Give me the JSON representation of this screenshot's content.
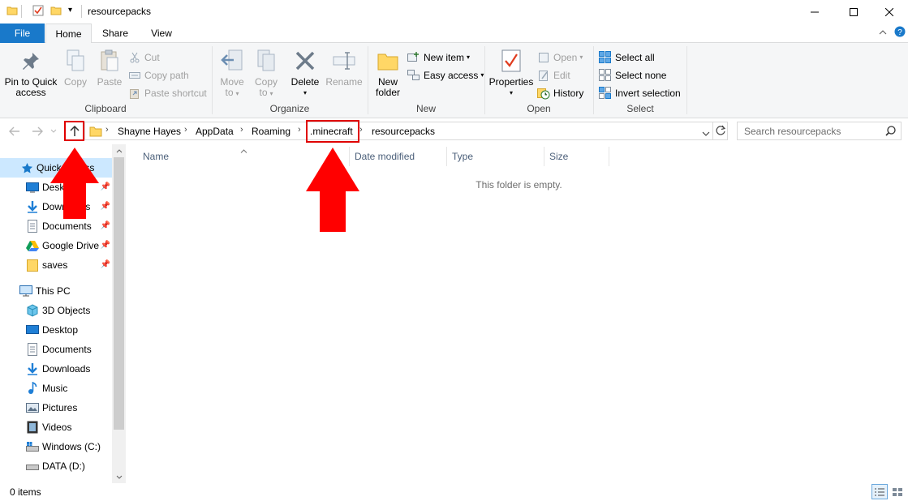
{
  "window": {
    "title": "resourcepacks",
    "qa_dropdown_glyph": "▾"
  },
  "tabs": [
    {
      "id": "file",
      "label": "File"
    },
    {
      "id": "home",
      "label": "Home"
    },
    {
      "id": "share",
      "label": "Share"
    },
    {
      "id": "view",
      "label": "View"
    }
  ],
  "ribbon": {
    "clipboard": {
      "label": "Clipboard",
      "pin_label_1": "Pin to Quick",
      "pin_label_2": "access",
      "copy_label": "Copy",
      "paste_label": "Paste",
      "cut_label": "Cut",
      "copy_path_label": "Copy path",
      "paste_shortcut_label": "Paste shortcut"
    },
    "organize": {
      "label": "Organize",
      "move_to_1": "Move",
      "move_to_2": "to",
      "copy_to_1": "Copy",
      "copy_to_2": "to",
      "delete_label": "Delete",
      "rename_label": "Rename"
    },
    "new": {
      "label": "New",
      "new_folder_1": "New",
      "new_folder_2": "folder",
      "new_item_label": "New item",
      "easy_access_label": "Easy access"
    },
    "open": {
      "label": "Open",
      "properties_label": "Properties",
      "open_label": "Open",
      "edit_label": "Edit",
      "history_label": "History"
    },
    "select": {
      "label": "Select",
      "select_all_label": "Select all",
      "select_none_label": "Select none",
      "invert_selection_label": "Invert selection"
    }
  },
  "address": {
    "crumbs": [
      "Shayne Hayes",
      "AppData",
      "Roaming",
      ".minecraft",
      "resourcepacks"
    ],
    "search_placeholder": "Search resourcepacks"
  },
  "nav_pane": {
    "quick_access": "Quick access",
    "quick_items": [
      "Desktop",
      "Downloads",
      "Documents",
      "Google Drive",
      "saves"
    ],
    "this_pc": "This PC",
    "pc_items": [
      "3D Objects",
      "Desktop",
      "Documents",
      "Downloads",
      "Music",
      "Pictures",
      "Videos",
      "Windows (C:)",
      "DATA (D:)"
    ]
  },
  "content": {
    "columns": [
      "Name",
      "Date modified",
      "Type",
      "Size"
    ],
    "empty_message": "This folder is empty."
  },
  "status": {
    "item_count": "0 items"
  },
  "colors": {
    "accent": "#1979ca",
    "highlight": "#e00000",
    "selection": "#cce8ff"
  }
}
